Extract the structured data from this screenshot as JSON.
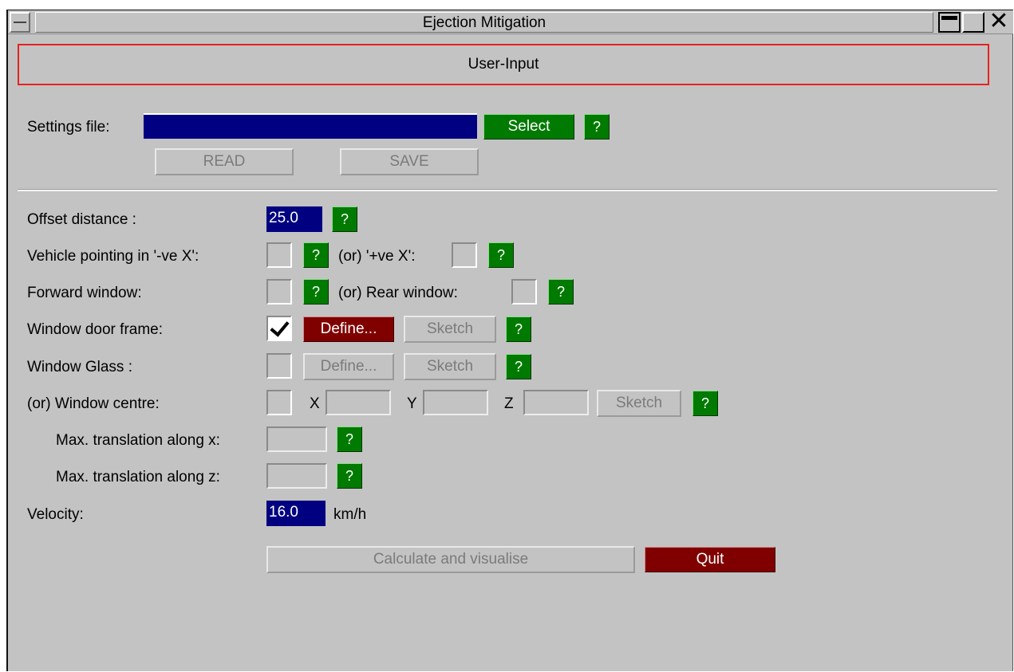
{
  "window": {
    "title": "Ejection Mitigation",
    "close_glyph": "✕"
  },
  "section": {
    "title": "User-Input"
  },
  "settings": {
    "label": "Settings file:",
    "file_value": "",
    "select_label": "Select",
    "help_label": "?",
    "read_label": "READ",
    "save_label": "SAVE"
  },
  "form": {
    "offset_label": "Offset distance :",
    "offset_value": "25.0",
    "vehicle_neg_label": "Vehicle pointing in '-ve X':",
    "vehicle_pos_label": "(or) '+ve X':",
    "forward_label": "Forward window:",
    "rear_label": "(or) Rear window:",
    "door_frame_label": "Window door frame:",
    "door_frame_checked": true,
    "glass_label": "Window Glass :",
    "define_label": "Define...",
    "sketch_label": "Sketch",
    "centre_label": "(or) Window centre:",
    "x_label": "X",
    "y_label": "Y",
    "z_label": "Z",
    "max_x_label": "Max. translation along x:",
    "max_z_label": "Max. translation along z:",
    "velocity_label": "Velocity:",
    "velocity_value": "16.0",
    "velocity_unit": "km/h",
    "help_label": "?"
  },
  "actions": {
    "calculate_label": "Calculate and visualise",
    "quit_label": "Quit"
  },
  "colors": {
    "accent_green": "#007a00",
    "accent_red": "#800000",
    "field_blue": "#000080",
    "header_border": "#e5231e"
  }
}
